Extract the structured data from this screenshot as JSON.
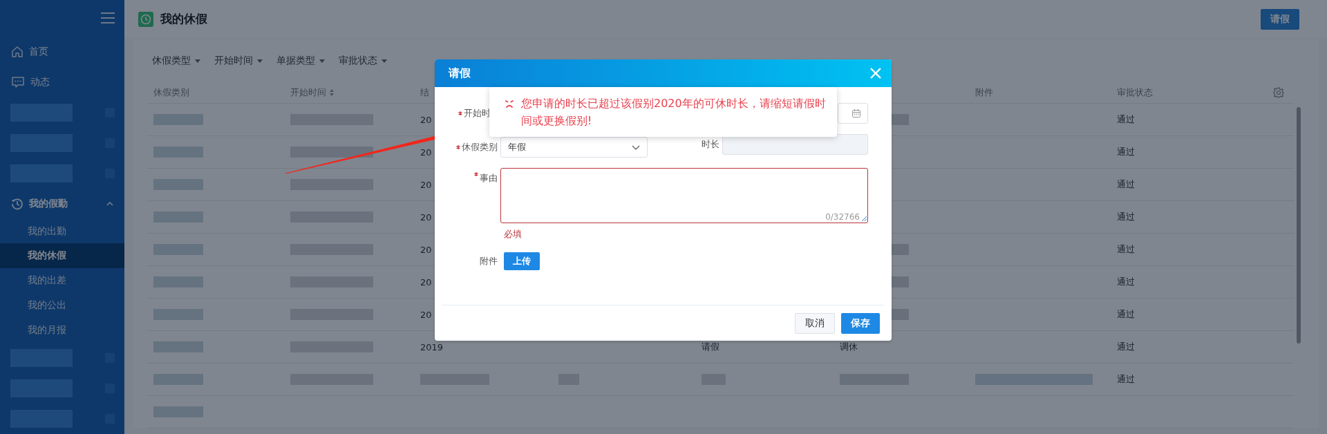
{
  "sidebar": {
    "items": [
      {
        "kind": "link",
        "label": "首页"
      },
      {
        "kind": "link",
        "label": "动态"
      },
      {
        "kind": "redacted"
      },
      {
        "kind": "redacted"
      },
      {
        "kind": "redacted"
      },
      {
        "kind": "group",
        "label": "我的假勤",
        "expanded": true,
        "children": [
          {
            "label": "我的出勤",
            "selected": false
          },
          {
            "label": "我的休假",
            "selected": true
          },
          {
            "label": "我的出差",
            "selected": false
          },
          {
            "label": "我的公出",
            "selected": false
          },
          {
            "label": "我的月报",
            "selected": false
          }
        ]
      },
      {
        "kind": "redacted"
      },
      {
        "kind": "redacted"
      },
      {
        "kind": "redacted"
      }
    ]
  },
  "header": {
    "title": "我的休假",
    "action_button": "请假"
  },
  "filters": [
    {
      "label": "休假类型"
    },
    {
      "label": "开始时间"
    },
    {
      "label": "单据类型"
    },
    {
      "label": "审批状态"
    }
  ],
  "table": {
    "columns": [
      {
        "label": "休假类别",
        "sortable": false
      },
      {
        "label": "开始时间",
        "sortable": true
      },
      {
        "label": "结",
        "sortable": false
      },
      null,
      null,
      null,
      {
        "label": "附件",
        "sortable": false
      },
      {
        "label": "审批状态",
        "sortable": false
      }
    ],
    "rows": [
      {
        "cells": [
          {
            "kind": "redacted"
          },
          {
            "kind": "redacted"
          },
          {
            "kind": "text",
            "text": "20"
          },
          null,
          null,
          {
            "kind": "redacted"
          },
          null,
          {
            "kind": "text",
            "text": "通过"
          }
        ]
      },
      {
        "cells": [
          {
            "kind": "redacted"
          },
          {
            "kind": "redacted"
          },
          {
            "kind": "text",
            "text": "20"
          },
          null,
          null,
          null,
          null,
          {
            "kind": "text",
            "text": "通过"
          }
        ]
      },
      {
        "cells": [
          {
            "kind": "redacted"
          },
          {
            "kind": "redacted"
          },
          {
            "kind": "text",
            "text": "20"
          },
          null,
          null,
          null,
          null,
          {
            "kind": "text",
            "text": "通过"
          }
        ]
      },
      {
        "cells": [
          {
            "kind": "redacted"
          },
          {
            "kind": "redacted"
          },
          {
            "kind": "text",
            "text": "20"
          },
          null,
          null,
          null,
          null,
          {
            "kind": "text",
            "text": "通过"
          }
        ]
      },
      {
        "cells": [
          {
            "kind": "redacted"
          },
          {
            "kind": "redacted"
          },
          {
            "kind": "text",
            "text": "20"
          },
          null,
          null,
          {
            "kind": "redacted"
          },
          null,
          {
            "kind": "text",
            "text": "通过"
          }
        ]
      },
      {
        "cells": [
          {
            "kind": "redacted"
          },
          {
            "kind": "redacted"
          },
          {
            "kind": "text",
            "text": "20"
          },
          null,
          null,
          {
            "kind": "redacted"
          },
          null,
          {
            "kind": "text",
            "text": "通过"
          }
        ]
      },
      {
        "cells": [
          {
            "kind": "redacted"
          },
          {
            "kind": "redacted"
          },
          {
            "kind": "text",
            "text": "20"
          },
          null,
          null,
          {
            "kind": "redacted"
          },
          null,
          {
            "kind": "text",
            "text": "通过"
          }
        ]
      },
      {
        "cells": [
          {
            "kind": "redacted"
          },
          {
            "kind": "redacted"
          },
          {
            "kind": "text",
            "text": "2019"
          },
          null,
          {
            "kind": "text",
            "text": "请假"
          },
          {
            "kind": "text",
            "text": "调休"
          },
          null,
          {
            "kind": "text",
            "text": "通过"
          }
        ]
      },
      {
        "cells": [
          {
            "kind": "redacted"
          },
          {
            "kind": "redacted"
          },
          {
            "kind": "redacted"
          },
          {
            "kind": "redacted"
          },
          {
            "kind": "redacted"
          },
          {
            "kind": "redacted"
          },
          {
            "kind": "redacted"
          },
          {
            "kind": "text",
            "text": "通过"
          }
        ]
      },
      {
        "cells": [
          {
            "kind": "redacted"
          },
          null,
          null,
          null,
          null,
          null,
          null,
          null
        ]
      }
    ]
  },
  "modal": {
    "title": "请假",
    "start_label": {
      "text": "开始时",
      "required": true
    },
    "leave_type": {
      "label": "休假类别",
      "required": true,
      "value": "年假"
    },
    "duration": {
      "label": "时长",
      "disabled": true
    },
    "reason": {
      "label": "事由",
      "required": true,
      "invalid": true,
      "counter": "0/32766",
      "error": "必填"
    },
    "attachment": {
      "label": "附件",
      "button": "上传"
    },
    "buttons": [
      {
        "label": "取消",
        "primary": false
      },
      {
        "label": "保存",
        "primary": true
      }
    ],
    "error_tooltip": {
      "text": "您申请的时长已超过该假别2020年的可休时长，请缩短请假时间或更换假别!"
    }
  }
}
